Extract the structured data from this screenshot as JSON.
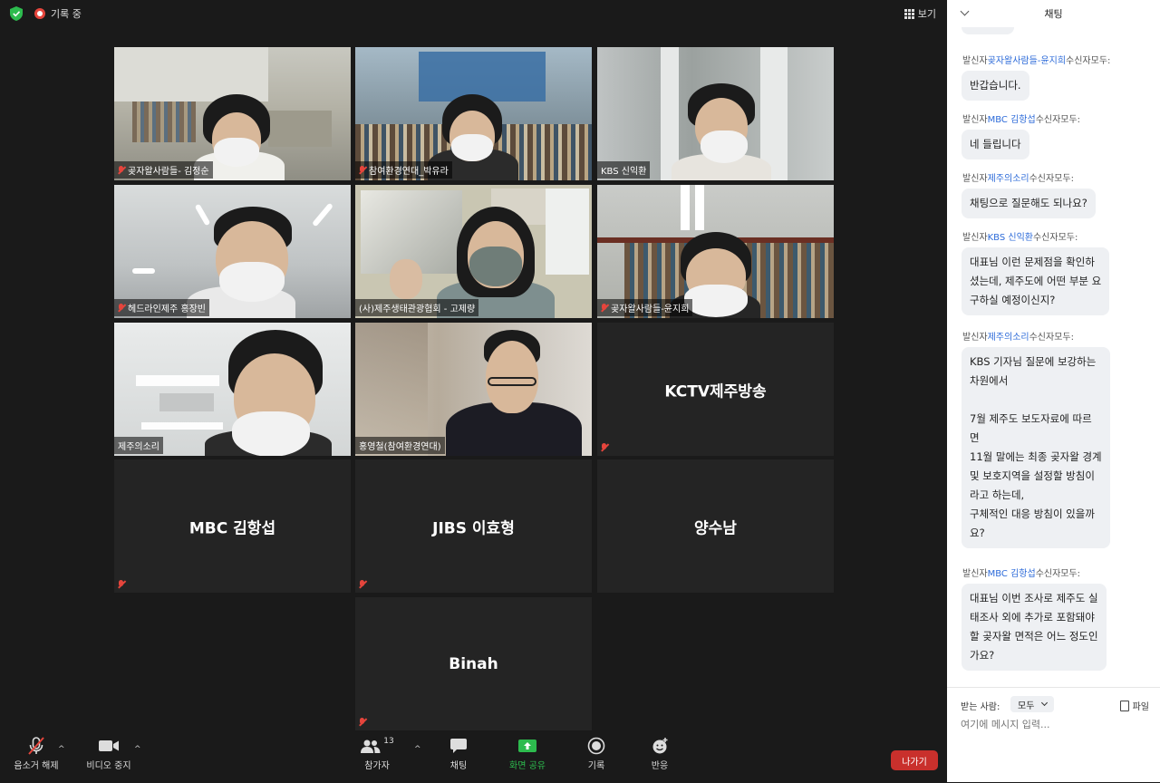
{
  "topbar": {
    "recording_label": "기록 중",
    "view_label": "보기"
  },
  "tiles": [
    {
      "id": "t1",
      "name": "곶자왈사람들- 김정순",
      "type": "video"
    },
    {
      "id": "t2",
      "name": "참여환경연대_박유라",
      "type": "video"
    },
    {
      "id": "t3",
      "name": "KBS 신익환",
      "type": "video"
    },
    {
      "id": "t4",
      "name": "헤드라인제주 홍장빈",
      "type": "video"
    },
    {
      "id": "t5",
      "name": "(사)제주생태관광협회 - 고제량",
      "type": "video",
      "active": true
    },
    {
      "id": "t6",
      "name": "곶자왈사람들-윤지희",
      "type": "video"
    },
    {
      "id": "t7",
      "name": "제주의소리",
      "type": "video"
    },
    {
      "id": "t8",
      "name": "홍영철(참여환경연대)",
      "type": "video"
    },
    {
      "id": "t9",
      "name": "KCTV제주방송",
      "type": "name"
    },
    {
      "id": "t10",
      "name": "MBC 김항섭",
      "type": "name"
    },
    {
      "id": "t11",
      "name": "JIBS 이효형",
      "type": "name"
    },
    {
      "id": "t12",
      "name": "양수남",
      "type": "name"
    },
    {
      "id": "t13",
      "name": "Binah",
      "type": "name"
    }
  ],
  "toolbar": {
    "mute_label": "음소거 해제",
    "video_label": "비디오 중지",
    "participants_label": "참가자",
    "participants_count": "13",
    "chat_label": "채팅",
    "share_label": "화면 공유",
    "record_label": "기록",
    "reactions_label": "반응",
    "leave_label": "나가기"
  },
  "chat": {
    "title": "채팅",
    "prefix": "발신자",
    "suffix": "수신자모두:",
    "messages": [
      {
        "sender": "곶자왈사람들-윤지희",
        "text": "반갑습니다."
      },
      {
        "sender": "MBC 김항섭",
        "text": "네 들립니다"
      },
      {
        "sender": "제주의소리",
        "text": "채팅으로 질문해도 되나요?"
      },
      {
        "sender": "KBS 신익환",
        "text": "대표님 이런 문제점을 확인하\n셨는데, 제주도에 어떤 부분 요\n구하실 예정이신지?"
      },
      {
        "sender": "제주의소리",
        "text": "KBS 기자님 질문에 보강하는\n차원에서\n\n7월 제주도 보도자료에 따르\n면\n11월 말에는 최종 곶자왈 경계\n및 보호지역을 설정할 방침이\n라고 하는데,\n구체적인 대응 방침이 있을까\n요?"
      },
      {
        "sender": "MBC 김항섭",
        "text": "대표님 이번 조사로 제주도 실\n태조사 외에 추가로 포함돼야\n할 곶자왈 면적은 어느 정도인\n가요?"
      }
    ],
    "to_label": "받는 사람:",
    "to_value": "모두",
    "file_label": "파일",
    "input_placeholder": "여기에 메시지 입력..."
  },
  "colors": {
    "accent_green": "#2dbb4e",
    "leave_red": "#c9302c",
    "active_speaker": "#c6d54a",
    "sender_blue": "#2d6bd9"
  }
}
